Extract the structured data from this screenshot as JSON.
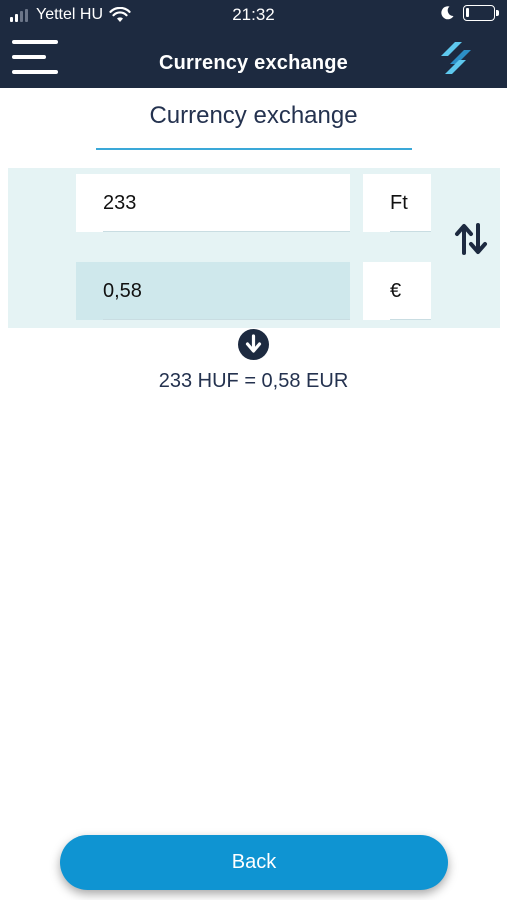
{
  "status_bar": {
    "carrier": "Yettel HU",
    "time": "21:32",
    "icons": [
      "signal-icon",
      "wifi-icon",
      "moon-icon",
      "battery-icon"
    ]
  },
  "nav": {
    "title": "Currency exchange",
    "icons": [
      "menu-icon",
      "app-logo-icon"
    ]
  },
  "page": {
    "title": "Currency exchange"
  },
  "exchange": {
    "from_amount": "233",
    "from_currency": "Ft",
    "to_amount": "0,58",
    "to_currency": "€",
    "result": "233 HUF = 0,58 EUR",
    "icons": [
      "swap-arrows-icon",
      "arrow-down-circle-icon"
    ]
  },
  "footer": {
    "back_label": "Back"
  },
  "colors": {
    "navbar": "#1d2a40",
    "accent": "#0f94d2",
    "panel": "#e5f3f4",
    "logo_light": "#5ec8ee",
    "logo_dark": "#2c8fc7"
  }
}
